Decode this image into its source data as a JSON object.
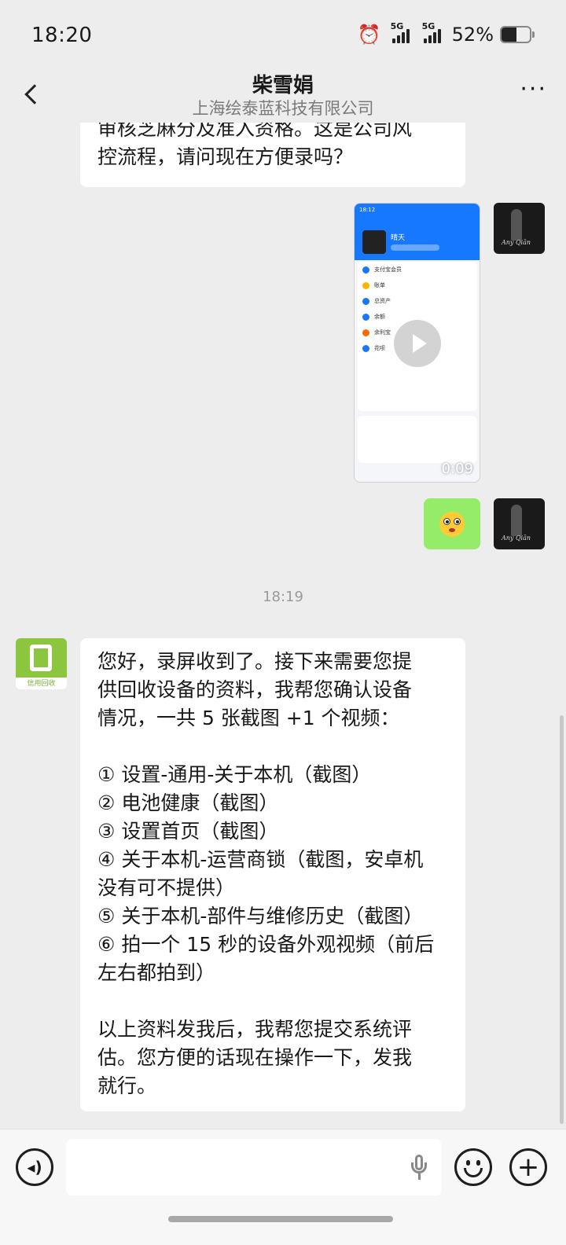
{
  "status": {
    "time": "18:20",
    "net1": "5G",
    "net2": "5G",
    "battery": "52%",
    "battery_level": 0.52
  },
  "header": {
    "title": "柴雪娟",
    "subtitle": "上海绘泰蓝科技有限公司",
    "more": "···"
  },
  "messages": {
    "top_partial": [
      "审核芝麻分及准入资格。这是公司风",
      "控流程，请问现在方便录吗？"
    ],
    "video": {
      "duration": "0:09",
      "screen_time": "18:12",
      "screen_name": "晴天",
      "rows": [
        "支付宝会员",
        "账单",
        "总资产",
        "余额",
        "余利宝",
        "花呗"
      ]
    },
    "timestamp": "18:19",
    "other_avatar_label": "信用回收",
    "main_lines": [
      "您好，录屏收到了。接下来需要您提",
      "供回收设备的资料，我帮您确认设备",
      "情况，一共 5 张截图 +1 个视频：",
      "",
      "① 设置-通用-关于本机（截图）",
      "② 电池健康（截图）",
      "③ 设置首页（截图）",
      "④ 关于本机-运营商锁（截图，安卓机",
      "没有可不提供）",
      "⑤ 关于本机-部件与维修历史（截图）",
      "⑥ 拍一个 15 秒的设备外观视频（前后",
      "左右都拍到）",
      "",
      "以上资料发我后，我帮您提交系统评",
      "估。您方便的话现在操作一下，发我",
      "就行。"
    ]
  },
  "my_avatar_text": "Any Qiān",
  "input": {
    "placeholder": ""
  },
  "icons": {
    "back": "chevron-left-icon",
    "more": "more-icon",
    "voice": "voice-icon",
    "mic": "microphone-icon",
    "emoji": "emoji-icon",
    "plus": "plus-icon"
  },
  "colors": {
    "background": "#ededed",
    "my_bubble": "#95ec69",
    "their_bubble": "#ffffff",
    "brand_green": "#8cc63f"
  }
}
